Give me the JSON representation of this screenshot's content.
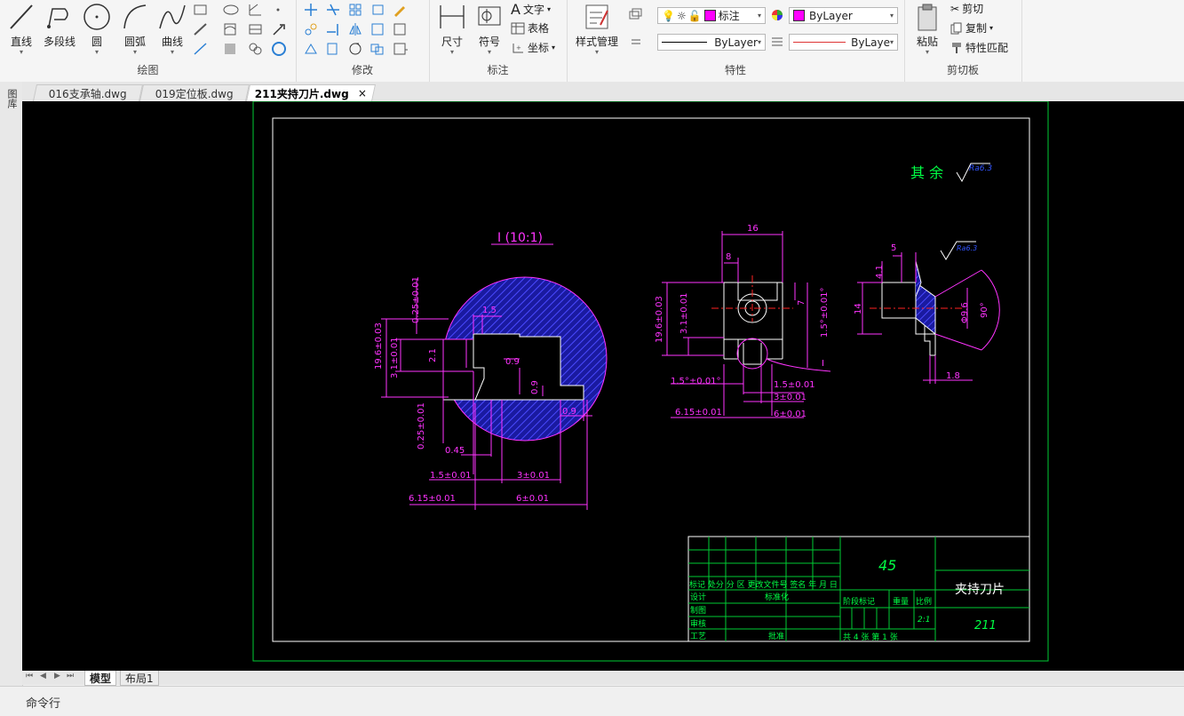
{
  "ribbon": {
    "draw": {
      "title": "绘图",
      "line": "直线",
      "polyline": "多段线",
      "circle": "圆",
      "arc": "圆弧",
      "curve": "曲线"
    },
    "modify": {
      "title": "修改"
    },
    "annotation": {
      "title": "标注",
      "dimension": "尺寸",
      "symbol": "符号",
      "text": "文字",
      "table": "表格",
      "coord": "坐标"
    },
    "properties": {
      "title": "特性",
      "style_manager": "样式管理",
      "layer_value": "标注",
      "color_value": "ByLayer",
      "linetype_value": "ByLayer",
      "lineweight_value": "ByLaye"
    },
    "clipboard": {
      "title": "剪切板",
      "paste": "粘贴",
      "cut": "剪切",
      "copy": "复制",
      "match": "特性匹配"
    }
  },
  "left_toolbar": {
    "label": "图库"
  },
  "tabs": [
    {
      "label": "016支承轴.dwg",
      "active": false
    },
    {
      "label": "019定位板.dwg",
      "active": false
    },
    {
      "label": "211夹持刀片.dwg",
      "active": true,
      "close": "×"
    }
  ],
  "drawing": {
    "roughness_note": "其 余",
    "roughness_value": "Ra6.3",
    "detail_label": "I (10:1)",
    "dims": {
      "d16": "16",
      "d8": "8",
      "d7": "7",
      "d15_01": "1.5°±0.01°",
      "d196": "19.6±0.03",
      "d31": "3.1±0.01",
      "d14": "14",
      "d5": "5",
      "d41": "4.1",
      "d96": "Φ9.6",
      "d90": "90°",
      "d18": "1.8",
      "d025a": "0.25±0.01",
      "d15": "1.5",
      "d21": "2.1",
      "d09a": "0.9",
      "d09b": "0.9",
      "d09c": "0.9",
      "d196b": "19.6±0.03",
      "d31b": "3.1±0.01",
      "d025b": "0.25±0.01",
      "d045": "0.45",
      "d15b": "1.5±0.01",
      "d3b": "3±0.01",
      "d615": "6.15±0.01",
      "d6": "6±0.01",
      "v15": "1.5°±0.01°",
      "v15b": "1.5±0.01",
      "v3": "3±0.01",
      "v615": "6.15±0.01",
      "v6": "6±0.01",
      "vI": "I",
      "ra_small": "Ra6.3"
    },
    "title_block": {
      "material": "45",
      "part_name": "夹持刀片",
      "drawing_no": "211",
      "header_row": "标记 处分 分 区 更改文件号 签名 年 月 日",
      "design": "设计",
      "drafting": "制图",
      "check": "审核",
      "process": "工艺",
      "standardize": "标准化",
      "approve": "批准",
      "stage_mark": "阶段标记",
      "weight": "重量",
      "scale": "比例",
      "scale_value": "2:1",
      "sheets": "共  4  张  第  1  张"
    }
  },
  "layout_tabs": [
    {
      "label": "模型",
      "active": true
    },
    {
      "label": "布局1",
      "active": false
    }
  ],
  "command_line": "命令行"
}
